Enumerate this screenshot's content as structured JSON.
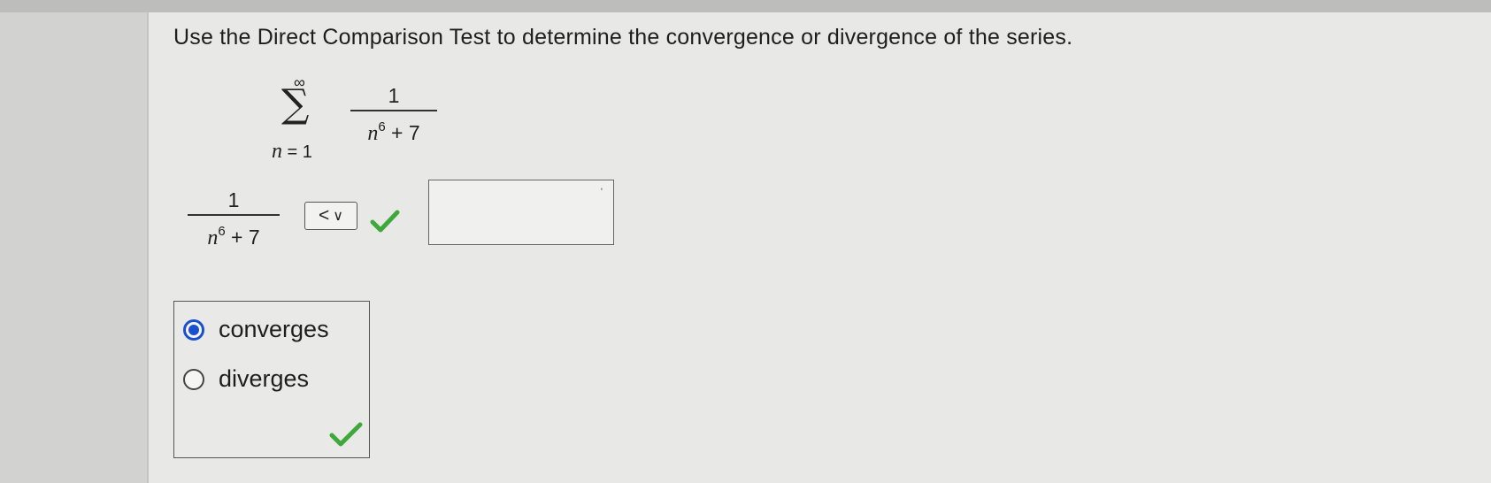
{
  "question": {
    "text": "Use the Direct Comparison Test to determine the convergence or divergence of the series."
  },
  "series": {
    "upper_limit": "∞",
    "lower_var": "n",
    "lower_eq": " = 1",
    "numerator": "1",
    "den_var": "n",
    "den_exp": "6",
    "den_rest": " + 7"
  },
  "comparison": {
    "numerator": "1",
    "den_var": "n",
    "den_exp": "6",
    "den_rest": " + 7",
    "operator_selected": "<",
    "operator_chevron": "∨",
    "answer_value": "",
    "input_marker": "'"
  },
  "choices": {
    "options": [
      {
        "label": "converges",
        "selected": true
      },
      {
        "label": "diverges",
        "selected": false
      }
    ]
  },
  "colors": {
    "check": "#3fa83a",
    "radio_selected": "#1a4fd0"
  },
  "icons": {
    "operator_check": "checkmark-icon",
    "choices_check": "checkmark-icon"
  }
}
